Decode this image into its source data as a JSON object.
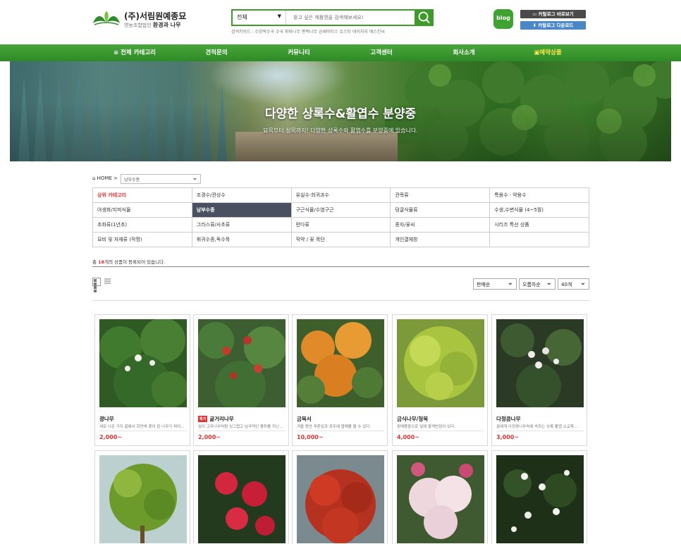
{
  "header": {
    "brand": "(주)서림원예종묘",
    "brand_sub_prefix": "영농조합법인",
    "brand_sub_main": "환경과 나무",
    "search_category": "전체",
    "search_placeholder": "찾고 싶은 제품명을 검색해보세요!",
    "keywords": "검색키워드 : 수양목수국 수국 파파나무 편백나무 금쇄마티스 호스타 데이지리 애스킨씨",
    "blog_label": "blog",
    "catalog_view": "카탈로그 바로보기",
    "catalog_download": "카탈로그 다운로드"
  },
  "nav": [
    {
      "label": "전체 카테고리"
    },
    {
      "label": "견적문의"
    },
    {
      "label": "커뮤니티"
    },
    {
      "label": "고객센터"
    },
    {
      "label": "회사소개"
    },
    {
      "label": "예약상품"
    }
  ],
  "banner": {
    "title": "다양한 상록수&활엽수 분양중",
    "desc": "묘목부터 성목까지! 다양한 상록수와 활엽수를 분양중에 있습니다.",
    "slides": 4,
    "active_slide": 4
  },
  "breadcrumb": {
    "home": "HOME >",
    "current": "남부수종"
  },
  "categories": [
    [
      "상위 카테고리",
      "조경수/관상수",
      "유실수·희귀과수",
      "관목류",
      "특용수 · 약용수"
    ],
    [
      "야생화/지피식물",
      "남부수종",
      "구근식물/수염구근",
      "덩굴식물류",
      "수생,수변식물 (4~5월)"
    ],
    [
      "초화류(1년초)",
      "그라스류/사초류",
      "란다류",
      "종자/꽃씨",
      "시리즈 특선 상품"
    ],
    [
      "묘비 및 자재류 (작명)",
      "휘귀수종,독수목",
      "작약 / 꽃 목단",
      "개인결재창",
      ""
    ]
  ],
  "listing": {
    "count_prefix": "총",
    "count": "18",
    "count_suffix": "개의 상품이 등록되어 있습니다.",
    "sort_order": "판매순",
    "sort_dir": "오름차순",
    "per_page": "40개"
  },
  "products": [
    {
      "name": "광나무",
      "desc": "새로 나온 가지 끝에서 하얀색 꽃이 핀 나무가 피어...",
      "price": "2,000~",
      "badge": ""
    },
    {
      "name": "굴거리나무",
      "desc": "잎이 고무나무처럼 싱그럽고 남국적인 풍취를 지닌...",
      "price": "2,000~",
      "badge": "특가"
    },
    {
      "name": "금목서",
      "desc": "겨울 동안 푸른잎과 좌우에 열매를 볼 수 있다.",
      "price": "10,000~",
      "badge": ""
    },
    {
      "name": "금식나무/청목",
      "desc": "판매품종으로 잎에 황색반점이 있다.",
      "price": "4,000~",
      "badge": ""
    },
    {
      "name": "다정큼나무",
      "desc": "꿈에게 다정큼나무속에 속하는 상록 활엽 소교목...",
      "price": "3,000~",
      "badge": ""
    },
    {
      "name": "",
      "desc": "",
      "price": "",
      "badge": ""
    },
    {
      "name": "",
      "desc": "",
      "price": "",
      "badge": ""
    },
    {
      "name": "",
      "desc": "",
      "price": "",
      "badge": ""
    },
    {
      "name": "",
      "desc": "",
      "price": "",
      "badge": ""
    },
    {
      "name": "",
      "desc": "",
      "price": "",
      "badge": ""
    }
  ],
  "colors": {
    "brand_green": "#3e9b2b",
    "nav_green": "#3a9a2f",
    "accent_red": "#d33333",
    "nav_highlight": "#ffe84a",
    "selected_category": "#4a5060"
  }
}
